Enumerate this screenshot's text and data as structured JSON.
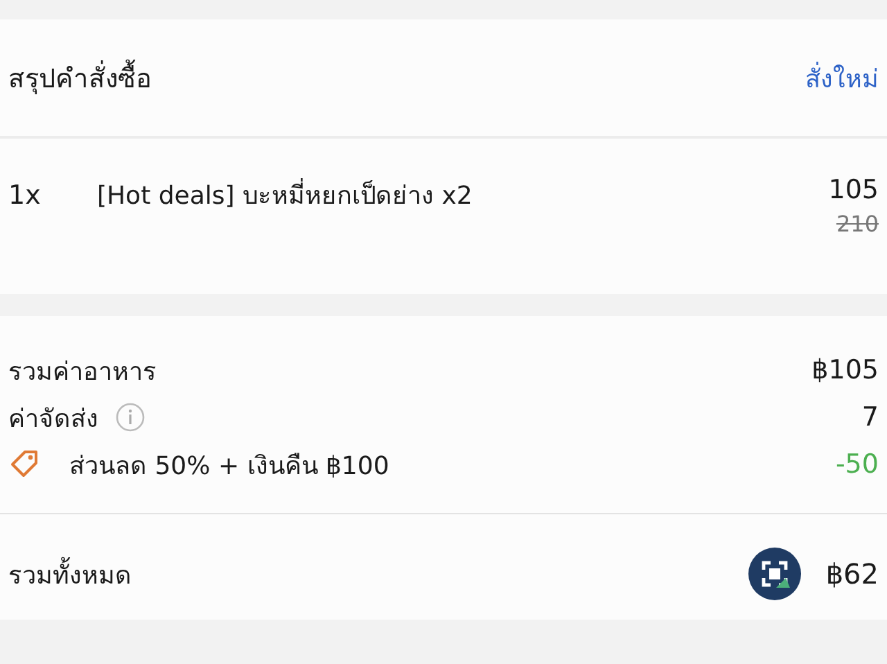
{
  "order_summary": {
    "title": "สรุปคำสั่งซื้อ",
    "action": "สั่งใหม่"
  },
  "items": [
    {
      "quantity": "1x",
      "name": "[Hot deals] บะหมี่หยกเป็ดย่าง x2",
      "price": "105",
      "original_price": "210"
    }
  ],
  "charges": [
    {
      "kind": "plain",
      "label": "รวมค่าอาหาร",
      "amount": "฿105"
    },
    {
      "kind": "info",
      "label": "ค่าจัดส่ง",
      "amount": "7"
    },
    {
      "kind": "discount",
      "label": "ส่วนลด 50% + เงินคืน ฿100",
      "amount": "-50"
    }
  ],
  "total": {
    "label": "รวมทั้งหมด",
    "amount": "฿62"
  }
}
